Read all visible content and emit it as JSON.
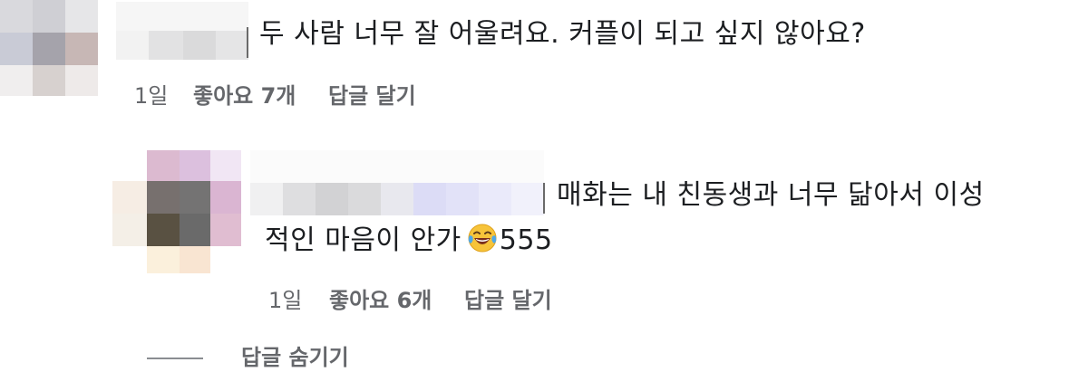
{
  "comments": [
    {
      "text": "두 사람 너무 잘 어울려요. 커플이 되고 싶지 않아요?",
      "meta": {
        "time": "1일",
        "like": "좋아요 7개",
        "reply": "답글 달기"
      }
    }
  ],
  "reply": {
    "text_line1": "매화는 내 친동생과 너무 닮아서 이성",
    "text_line2": "적인 마음이 안가",
    "emoji": "laughing-with-tears-emoji",
    "suffix": "555",
    "meta": {
      "time": "1일",
      "like": "좋아요 6개",
      "reply": "답글 달기"
    }
  },
  "hide_replies": "답글 숨기기",
  "colors": {
    "text": "#1c1e21",
    "meta": "#65676b",
    "background": "#ffffff"
  }
}
